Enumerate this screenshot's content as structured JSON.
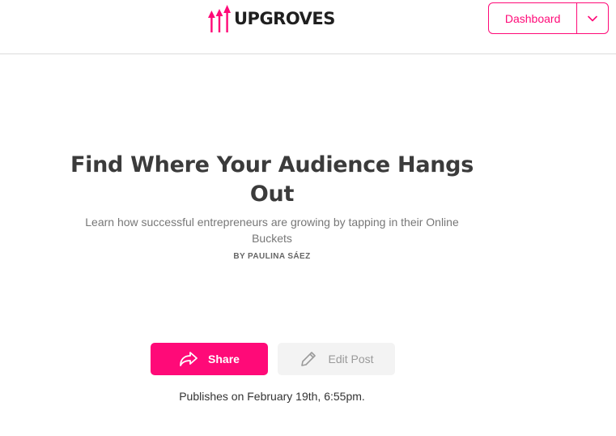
{
  "header": {
    "logo_text": "UPGROVES",
    "dashboard_label": "Dashboard",
    "dropdown_icon": "chevron-down-icon"
  },
  "article": {
    "title": "Find Where Your Audience Hangs Out",
    "subtitle": "Learn how successful entrepreneurs are growing by tapping in their Online Buckets",
    "byline": "BY PAULINA SÁEZ"
  },
  "actions": {
    "share_label": "Share",
    "share_icon": "share-arrow-icon",
    "edit_label": "Edit Post",
    "edit_icon": "pencil-icon"
  },
  "publish_note": "Publishes on February 19th, 6:55pm.",
  "colors": {
    "accent": "#ff0a78",
    "text": "#3b3b3b",
    "muted": "#777777",
    "edit_bg": "#f3f3f3"
  }
}
